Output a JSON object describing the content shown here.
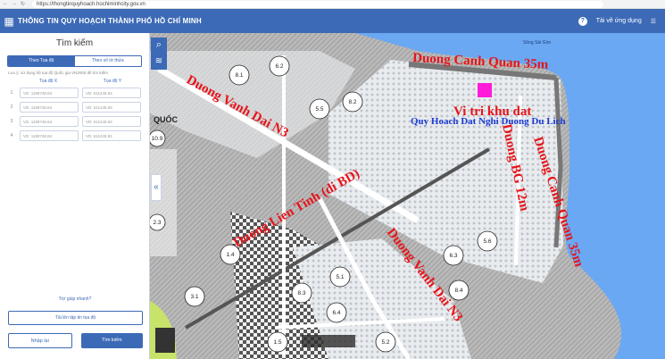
{
  "browser": {
    "url": "https://thongtinquyhoach.hochiminhcity.gov.vn"
  },
  "app": {
    "title": "THÔNG TIN QUY HOẠCH THÀNH PHỐ HỒ CHÍ MINH",
    "help_label": "?",
    "download_label": "Tải về ứng dụng"
  },
  "search": {
    "title": "Tìm kiếm",
    "tabs": [
      {
        "label": "Theo Tọa độ",
        "active": true
      },
      {
        "label": "Theo số tờ thửa",
        "active": false
      }
    ],
    "note": "Lưu ý: sử dụng hệ tọa độ Quốc gia VN2000 để tìm kiếm",
    "col_x": "Tọa độ X",
    "col_y": "Tọa độ Y",
    "rows": [
      {
        "num": "1",
        "x": "VD: 1199748.84",
        "y": "VD: 611245.93"
      },
      {
        "num": "2",
        "x": "VD: 1199748.84",
        "y": "VD: 611245.93"
      },
      {
        "num": "3",
        "x": "VD: 1199748.84",
        "y": "VD: 611245.93"
      },
      {
        "num": "4",
        "x": "VD: 1199748.84",
        "y": "VD: 611245.93"
      }
    ],
    "help_link": "Trợ giúp nhanh?",
    "upload_label": "Tải lên tập tin tọa độ",
    "clear_label": "Nhập lại",
    "submit_label": "Tìm kiếm"
  },
  "map": {
    "labels": {
      "duong_canh_quan_top": "Duong Canh Quan 35m",
      "duong_vanh_dai_n3_left": "Duong Vanh Dai N3",
      "vi_tri_khu_dat": "Vi tri khu dat",
      "quy_hoach": "Quy Hoach Dat Nghi Duong Du Lich",
      "duong_lien_tinh": "Duong Lien Tinh (di BD)",
      "duong_bg": "Duong BG 12m",
      "duong_canh_quan_right": "Duong Canh Quan 35m",
      "duong_vanh_dai_n3_bottom": "Duong Vanh Dai N3",
      "song_sai_gon": "Sông Sài Gòn",
      "quoc": "QUỐC"
    },
    "zones": [
      "8.1",
      "6.2",
      "5.5",
      "8.2",
      "10.9",
      "2.3",
      "1.4",
      "3.1",
      "8.3",
      "5.1",
      "6.3",
      "5.6",
      "8.4",
      "6.4",
      "1.5",
      "5.2"
    ],
    "site_color": "#ff1ad9"
  }
}
